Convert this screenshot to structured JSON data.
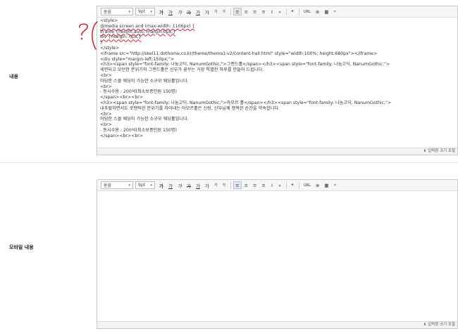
{
  "rows": [
    {
      "label": "내용"
    },
    {
      "label": "모바일 내용"
    }
  ],
  "toolbar": {
    "font_value": "돋움",
    "size_value": "9pt",
    "buttons": [
      "가",
      "가",
      "가",
      "가",
      "가",
      "가",
      "가",
      "가",
      "≡",
      "≡",
      "≡",
      "≡",
      "Ⅰ",
      "»",
      "❝",
      "URL",
      "⊛",
      "▦",
      "⌕"
    ]
  },
  "editor1_content": {
    "lines": [
      "<style>",
      "@media screen and (max-width: 1106px) {",
      "iframe {height:auto; margin:0px;}",
      "div {margin: 0px;}",
      "}",
      "</style>",
      "<iframe src=\"http://skel11.dothome.co.kr/theme/thema1-v2/content-hall.html\" style=\"width:100%; height:680px\"></iframe>",
      "<div style=\"margin-left:150px;\">",
      "<h3><span style=\"font-family: 나눔고딕, NanumGothic;\">그랜드홀</span></h3><span style=\"font-family: 나눔고딕, NanumGothic;\">",
      "세련되고 모던한 분위기의 그랜드홀은 신부가 꿈꾸는 가장 특별한 하루를 만들어 드립니다.",
      "<br>",
      "아담한 스몰 웨딩이 가능한 소규모 웨딩홀입니다.",
      "<br>",
      "- 동시수용 : 200석(최소보증인원 150명)",
      "</span><br><br>",
      "<h3><span style=\"font-family: 나눔고딕, NanumGothic;\">아모르 홀</span></h3><span style=\"font-family: 나눔고딕, NanumGothic;\">",
      "내추럴하면서도 로맨틱한 분위기를 자아내는 아모르홀은 신랑, 신부님께 행복한 순간을 약속합니다.",
      "<br>",
      "아담한 스몰 웨딩이 가능한 소규모 웨딩홀입니다.",
      "<br>",
      "- 동시수용 : 200석(최소보증인원 150명)",
      "</span><br><br>"
    ]
  },
  "resize_label": "입력창 크기 조절",
  "annotation_text": "?"
}
